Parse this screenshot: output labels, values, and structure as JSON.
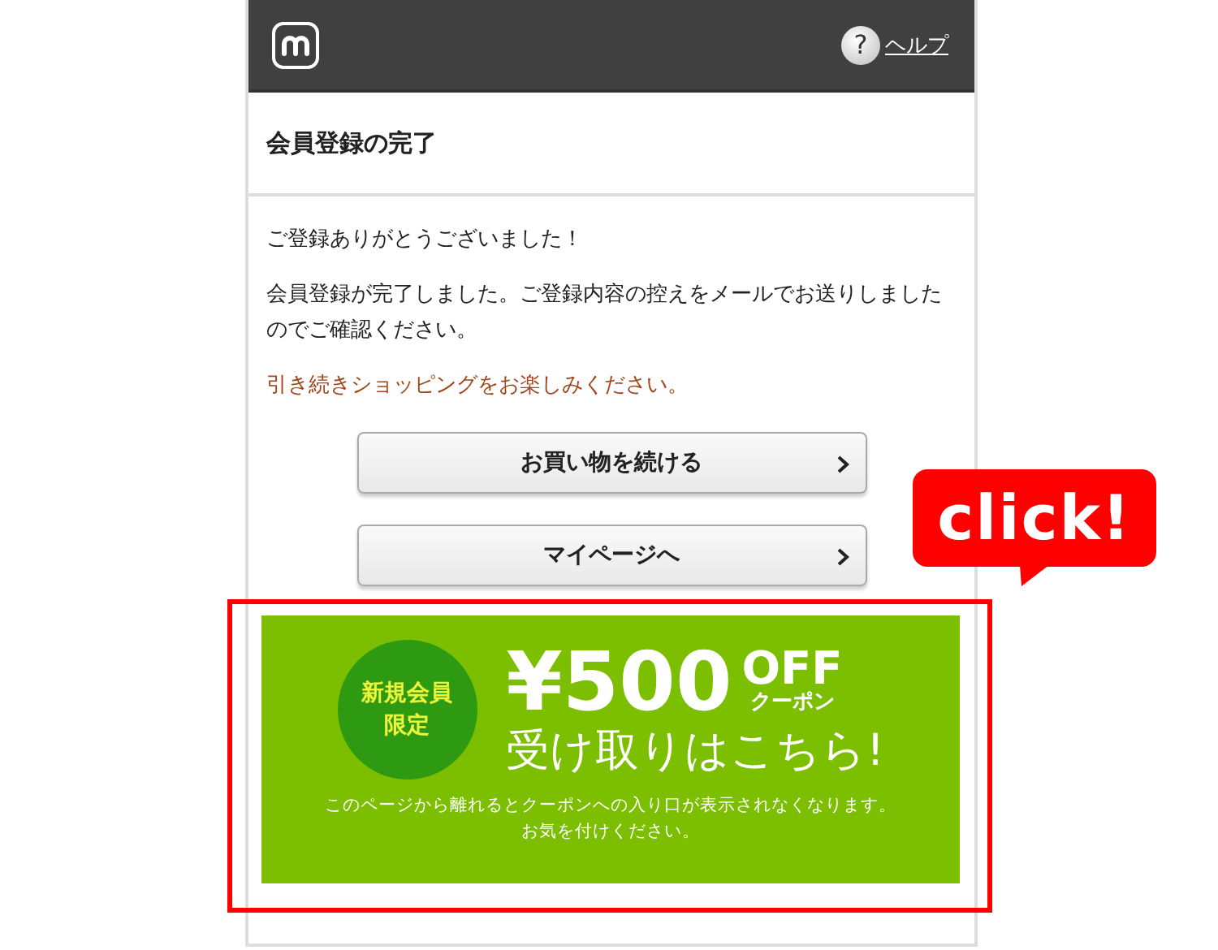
{
  "header": {
    "help_icon": "?",
    "help_link": "ヘルプ"
  },
  "title": "会員登録の完了",
  "messages": [
    "ご登録ありがとうございました！",
    "会員登録が完了しました。ご登録内容の控えをメールでお送りしましたのでご確認ください。"
  ],
  "note": "引き続きショッピングをお楽しみください。",
  "buttons": [
    {
      "label": "お買い物を続ける"
    },
    {
      "label": "マイページへ"
    }
  ],
  "banner": {
    "badge": "新規会員限定",
    "amount": "¥500",
    "off": "OFF",
    "coupon": "クーポン",
    "cta": "受け取りはこちら!",
    "notice_lines": [
      "このページから離れるとクーポンへの入り口が表示されなくなります。",
      "お気を付けください。"
    ]
  },
  "annotation": {
    "callout": "click!"
  }
}
